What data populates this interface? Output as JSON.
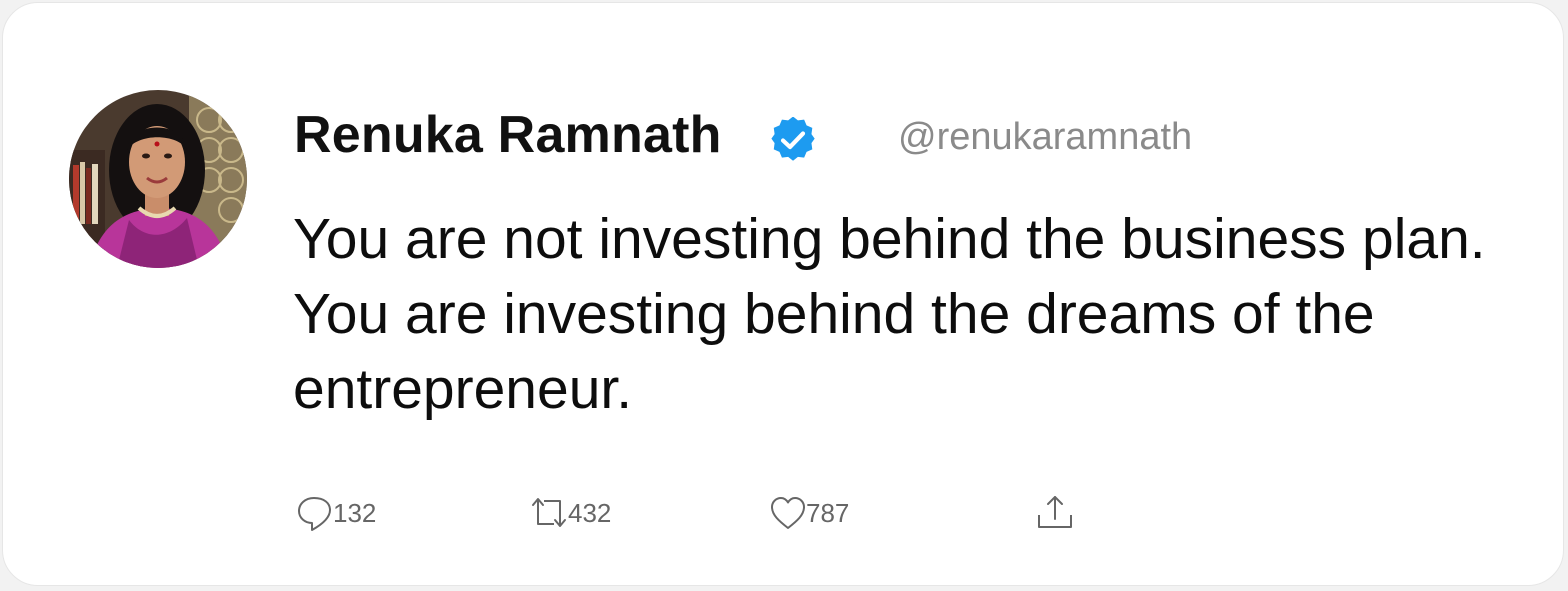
{
  "tweet": {
    "author": {
      "name": "Renuka Ramnath",
      "handle": "@renukaramnath",
      "verified": true,
      "avatar_icon": "profile-photo"
    },
    "text": "You are not investing behind the business plan. You are investing behind the dreams of the entrepreneur.",
    "actions": {
      "reply": {
        "icon": "reply-icon",
        "count": "132"
      },
      "retweet": {
        "icon": "retweet-icon",
        "count": "432"
      },
      "like": {
        "icon": "heart-icon",
        "count": "787"
      },
      "share": {
        "icon": "share-icon"
      }
    }
  },
  "colors": {
    "verified_badge": "#1d9bf0",
    "name_text": "#111111",
    "handle_text": "#8a8a8a",
    "count_text": "#666666"
  }
}
